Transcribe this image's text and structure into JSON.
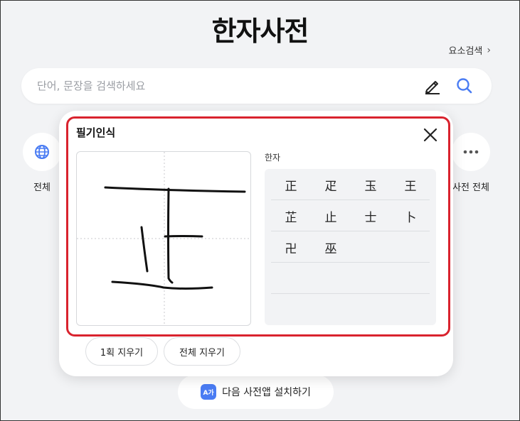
{
  "header": {
    "title": "한자사전",
    "element_search": "요소검색"
  },
  "search": {
    "placeholder": "단어, 문장을 검색하세요"
  },
  "categories": {
    "all": "전체",
    "dict_all": "사전 전체"
  },
  "install": {
    "label": "다음 사전앱 설치하기",
    "icon_text": "A가"
  },
  "handwriting": {
    "title": "필기인식",
    "result_label": "한자",
    "undo_stroke": "1획 지우기",
    "clear_all": "전체 지우기",
    "candidates": [
      [
        "正",
        "疋",
        "玉",
        "王"
      ],
      [
        "芷",
        "止",
        "士",
        "卜"
      ],
      [
        "卍",
        "巫"
      ]
    ]
  },
  "colors": {
    "accent": "#4a7cf3",
    "highlight": "#d9232e"
  }
}
